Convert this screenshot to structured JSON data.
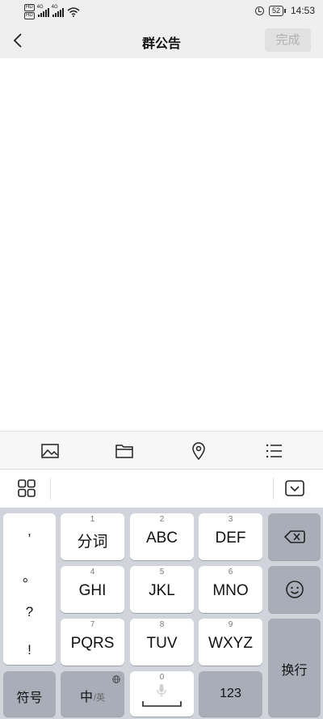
{
  "status": {
    "hd1": "HD",
    "hd2": "HD",
    "net1": "4G",
    "net2": "4G",
    "battery": "52",
    "time": "14:53"
  },
  "header": {
    "title": "群公告",
    "done_label": "完成"
  },
  "toolbar": {
    "items": [
      "image-icon",
      "folder-icon",
      "location-icon",
      "list-icon"
    ]
  },
  "keyboard": {
    "punct": [
      ",",
      "。",
      "?",
      "!"
    ],
    "keys": [
      {
        "num": "1",
        "label": "分词"
      },
      {
        "num": "2",
        "label": "ABC"
      },
      {
        "num": "3",
        "label": "DEF"
      },
      {
        "num": "4",
        "label": "GHI"
      },
      {
        "num": "5",
        "label": "JKL"
      },
      {
        "num": "6",
        "label": "MNO"
      },
      {
        "num": "7",
        "label": "PQRS"
      },
      {
        "num": "8",
        "label": "TUV"
      },
      {
        "num": "9",
        "label": "WXYZ"
      }
    ],
    "enter": "换行",
    "symbols": "符号",
    "lang_main": "中",
    "lang_alt": "/英",
    "space_num": "0",
    "numbers": "123"
  },
  "colors": {
    "header_bg": "#efefef",
    "keyboard_bg": "#d2d4db",
    "dark_key": "#a8adb8",
    "done_bg": "#e1e1e1",
    "done_text": "#b1b1b1"
  }
}
